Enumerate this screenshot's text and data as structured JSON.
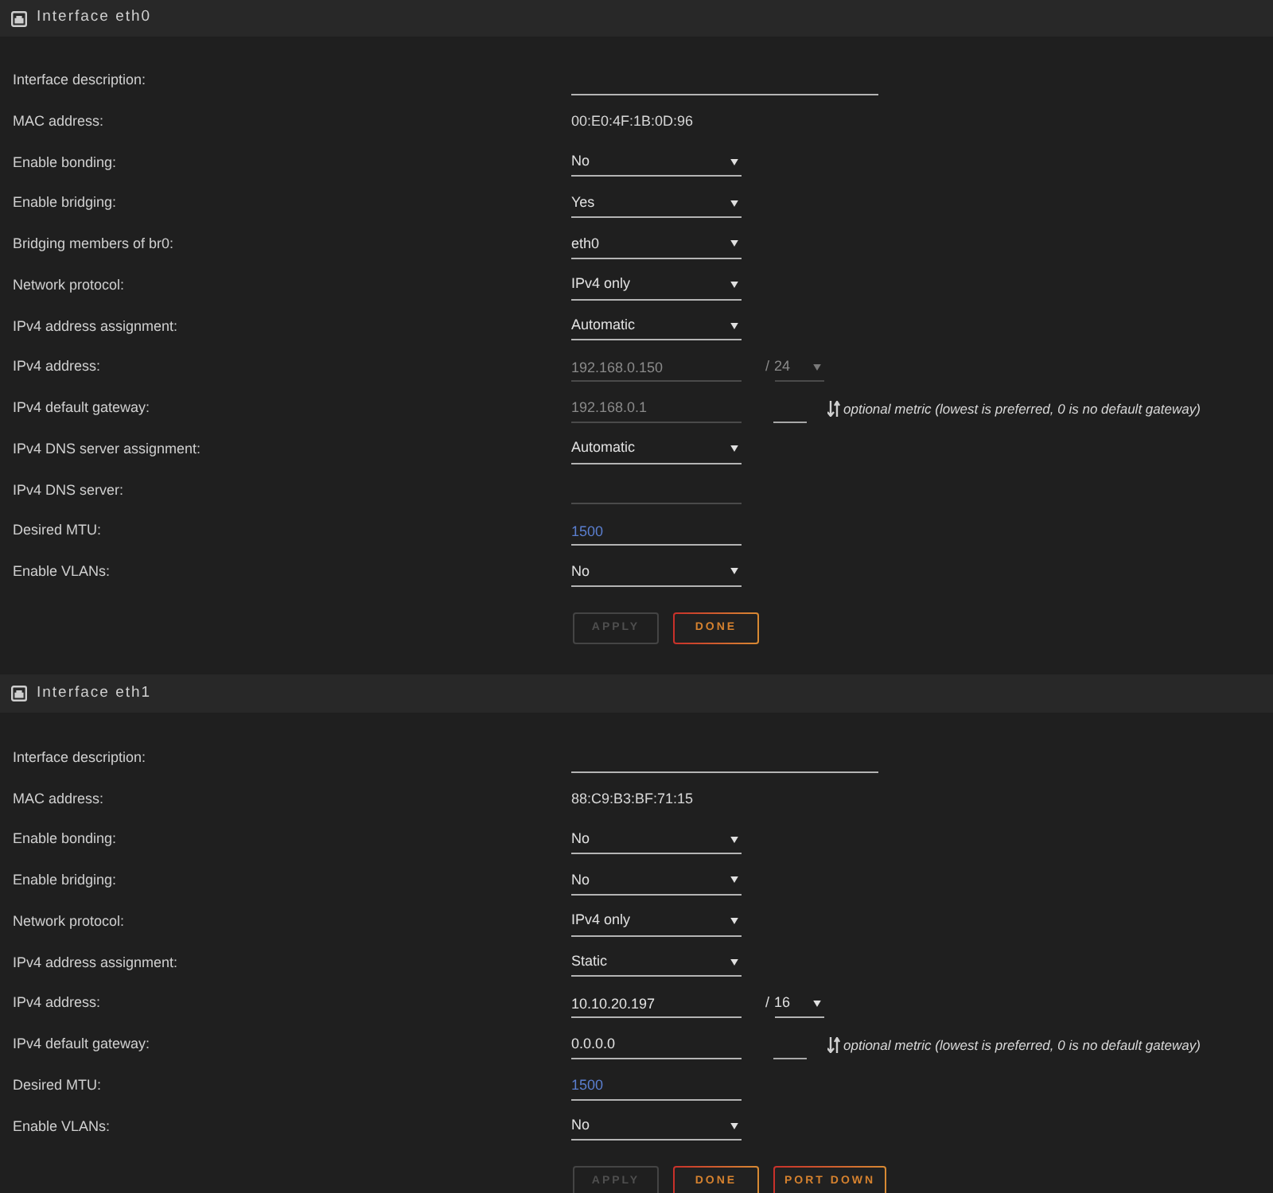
{
  "sections": [
    {
      "title": "Interface eth0",
      "fields": [
        {
          "kind": "longinput",
          "label": "Interface description:",
          "disabled": false
        },
        {
          "kind": "text",
          "label": "MAC address:",
          "value": "00:E0:4F:1B:0D:96"
        },
        {
          "kind": "select",
          "label": "Enable bonding:",
          "value": "No",
          "disabled": false
        },
        {
          "kind": "select",
          "label": "Enable bridging:",
          "value": "Yes",
          "disabled": false
        },
        {
          "kind": "select",
          "label": "Bridging members of br0:",
          "value": "eth0",
          "disabled": false
        },
        {
          "kind": "select",
          "label": "Network protocol:",
          "value": "IPv4 only",
          "disabled": false
        },
        {
          "kind": "select",
          "label": "IPv4 address assignment:",
          "value": "Automatic",
          "disabled": false
        },
        {
          "kind": "address",
          "label": "IPv4 address:",
          "value": "192.168.0.150",
          "disabled": true,
          "separator": "/",
          "prefix": {
            "value": "24",
            "disabled": true
          }
        },
        {
          "kind": "gateway",
          "label": "IPv4 default gateway:",
          "value": "192.168.0.1",
          "disabled": true,
          "hint": "optional metric (lowest is preferred, 0 is no default gateway)"
        },
        {
          "kind": "select",
          "label": "IPv4 DNS server assignment:",
          "value": "Automatic",
          "disabled": false
        },
        {
          "kind": "input",
          "label": "IPv4 DNS server:",
          "disabled": true
        },
        {
          "kind": "number",
          "label": "Desired MTU:",
          "value": "1500",
          "disabled": false
        },
        {
          "kind": "select",
          "label": "Enable VLANs:",
          "value": "No",
          "disabled": false
        }
      ],
      "buttons": [
        {
          "label": "APPLY",
          "disabled": true
        },
        {
          "label": "DONE",
          "disabled": false
        }
      ]
    },
    {
      "title": "Interface eth1",
      "fields": [
        {
          "kind": "longinput",
          "label": "Interface description:",
          "disabled": false
        },
        {
          "kind": "text",
          "label": "MAC address:",
          "value": "88:C9:B3:BF:71:15"
        },
        {
          "kind": "select",
          "label": "Enable bonding:",
          "value": "No",
          "disabled": false
        },
        {
          "kind": "select",
          "label": "Enable bridging:",
          "value": "No",
          "disabled": false
        },
        {
          "kind": "select",
          "label": "Network protocol:",
          "value": "IPv4 only",
          "disabled": false
        },
        {
          "kind": "select",
          "label": "IPv4 address assignment:",
          "value": "Static",
          "disabled": false
        },
        {
          "kind": "address",
          "label": "IPv4 address:",
          "value": "10.10.20.197",
          "disabled": false,
          "separator": "/",
          "prefix": {
            "value": "16",
            "disabled": false
          }
        },
        {
          "kind": "gateway",
          "label": "IPv4 default gateway:",
          "value": "0.0.0.0",
          "disabled": false,
          "hint": "optional metric (lowest is preferred, 0 is no default gateway)"
        },
        {
          "kind": "number",
          "label": "Desired MTU:",
          "value": "1500",
          "disabled": false
        },
        {
          "kind": "select",
          "label": "Enable VLANs:",
          "value": "No",
          "disabled": false
        }
      ],
      "buttons": [
        {
          "label": "APPLY",
          "disabled": true
        },
        {
          "label": "DONE",
          "disabled": false
        },
        {
          "label": "PORT DOWN",
          "disabled": false
        }
      ]
    }
  ]
}
